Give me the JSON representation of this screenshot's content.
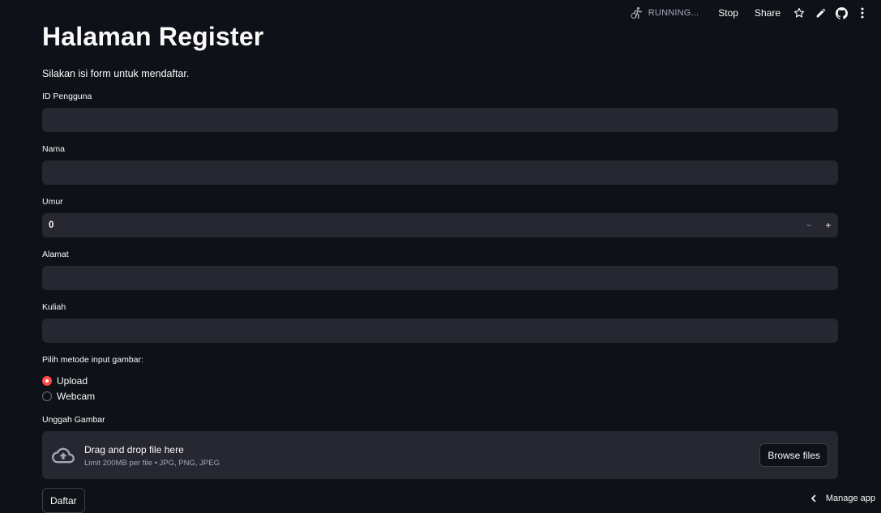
{
  "toolbar": {
    "status_icon": "running-person-icon",
    "status_text": "RUNNING...",
    "stop_label": "Stop",
    "share_label": "Share",
    "icons": [
      "star-icon",
      "pencil-icon",
      "github-icon",
      "more-vertical-icon"
    ]
  },
  "page": {
    "title": "Halaman Register",
    "subtitle": "Silakan isi form untuk mendaftar."
  },
  "form": {
    "id_label": "ID Pengguna",
    "id_value": "",
    "nama_label": "Nama",
    "nama_value": "",
    "umur_label": "Umur",
    "umur_value": "0",
    "umur_minus": "−",
    "umur_plus": "+",
    "alamat_label": "Alamat",
    "alamat_value": "",
    "kuliah_label": "Kuliah",
    "kuliah_value": "",
    "method_label": "Pilih metode input gambar:",
    "method_options": [
      {
        "label": "Upload",
        "selected": true
      },
      {
        "label": "Webcam",
        "selected": false
      }
    ],
    "upload_label": "Unggah Gambar",
    "dropzone_title": "Drag and drop file here",
    "dropzone_subtitle": "Limit 200MB per file • JPG, PNG, JPEG",
    "browse_label": "Browse files",
    "submit_label": "Daftar"
  },
  "footer": {
    "manage_app_label": "Manage app"
  },
  "colors": {
    "background": "#0e1117",
    "input_bg": "#262730",
    "accent": "#ff4b4b",
    "text": "#fafafa",
    "muted_text": "#a3a8b8"
  }
}
